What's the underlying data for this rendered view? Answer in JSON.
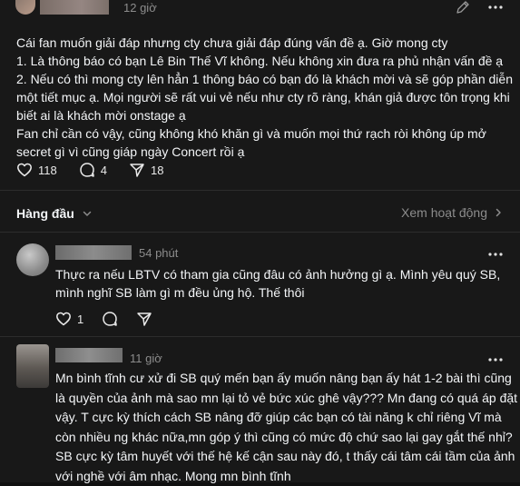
{
  "post": {
    "time": "12 giờ",
    "body_lines": [
      "Cái fan muốn giải đáp nhưng cty chưa giải đáp đúng vấn đề ạ. Giờ mong cty",
      "1. Là thông báo có bạn Lê Bin Thế Vĩ không. Nếu không xin đưa ra phủ nhận vấn đề ạ",
      "2. Nếu có thì mong cty lên hẳn 1 thông báo có bạn đó là khách mời và sẽ góp phần diễn",
      "một tiết mục ạ. Mọi người sẽ rất vui vẻ nếu như cty rõ ràng, khán giả được tôn trọng khi",
      "biết ai là khách mời onstage ạ",
      "Fan chỉ cần có vậy, cũng không khó khăn gì và muốn mọi thứ rạch ròi không úp mở",
      "secret gì vì cũng giáp ngày Concert rồi ạ"
    ],
    "likes": "118",
    "comments": "4",
    "shares": "18"
  },
  "sort": {
    "label": "Hàng đầu",
    "activity_label": "Xem hoạt động"
  },
  "replies": [
    {
      "time": "54 phút",
      "body_lines": [
        "Thực ra nếu LBTV có tham gia cũng đâu có ảnh hưởng gì ạ. Mình yêu quý SB,",
        "mình nghĩ SB làm gì m đều ủng hộ. Thế thôi"
      ],
      "likes": "1"
    },
    {
      "time": "11 giờ",
      "body_lines": [
        "Mn bình tĩnh cư xử đi SB quý mến bạn ấy muốn nâng bạn ấy hát 1-2 bài thì cũng",
        "là quyền của ảnh mà sao mn lại tỏ vẻ bức xúc ghê vậy??? Mn đang có quá áp đặt k",
        "vậy. T cực kỳ thích cách SB nâng đỡ giúp các bạn có tài năng k chỉ riêng Vĩ mà",
        "còn nhiều ng khác nữa,mn góp ý thì cũng có mức độ chứ sao lại gay gắt thế nhỉ?",
        "SB cực kỳ tâm huyết với thế hệ kế cận sau này đó, t thấy cái tâm cái tầm của ảnh",
        "với nghề với âm nhạc. Mong mn bình tĩnh"
      ]
    }
  ],
  "icons": [
    "edit-icon",
    "more-icon",
    "heart-icon",
    "comment-icon",
    "share-icon",
    "chevron-down-icon",
    "chevron-right-icon"
  ]
}
